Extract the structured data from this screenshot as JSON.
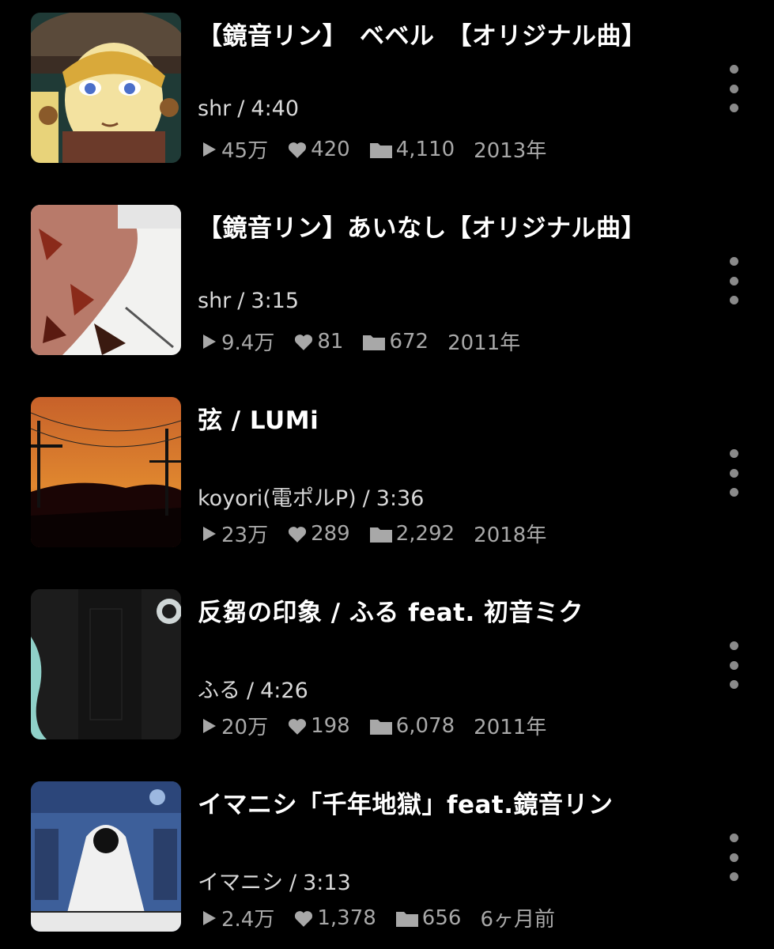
{
  "videos": [
    {
      "title": "【鏡音リン】　ベベル　【オリジナル曲】",
      "artist": "shr",
      "duration": "4:40",
      "views": "45万",
      "likes": "420",
      "mylist": "4,110",
      "date": "2013年",
      "more_icon": "more-vertical-icon"
    },
    {
      "title": "【鏡音リン】あいなし【オリジナル曲】",
      "artist": "shr",
      "duration": "3:15",
      "views": "9.4万",
      "likes": "81",
      "mylist": "672",
      "date": "2011年",
      "more_icon": "more-vertical-icon"
    },
    {
      "title": "弦 / LUMi",
      "artist": "koyori(電ポルP)",
      "duration": "3:36",
      "views": "23万",
      "likes": "289",
      "mylist": "2,292",
      "date": "2018年",
      "more_icon": "more-vertical-icon"
    },
    {
      "title": "反芻の印象 / ふる feat. 初音ミク",
      "artist": "ふる",
      "duration": "4:26",
      "views": "20万",
      "likes": "198",
      "mylist": "6,078",
      "date": "2011年",
      "more_icon": "more-vertical-icon"
    },
    {
      "title": "イマニシ「千年地獄」feat.鏡音リン",
      "artist": "イマニシ",
      "duration": "3:13",
      "views": "2.4万",
      "likes": "1,378",
      "mylist": "656",
      "date": "6ヶ月前",
      "more_icon": "more-vertical-icon"
    }
  ],
  "separator": "/",
  "icons": {
    "views": "play-icon",
    "likes": "heart-icon",
    "mylist": "folder-icon"
  },
  "colors": {
    "background": "#000000",
    "title": "#ffffff",
    "meta": "#d8d8d8",
    "stats": "#a8a8a8"
  }
}
